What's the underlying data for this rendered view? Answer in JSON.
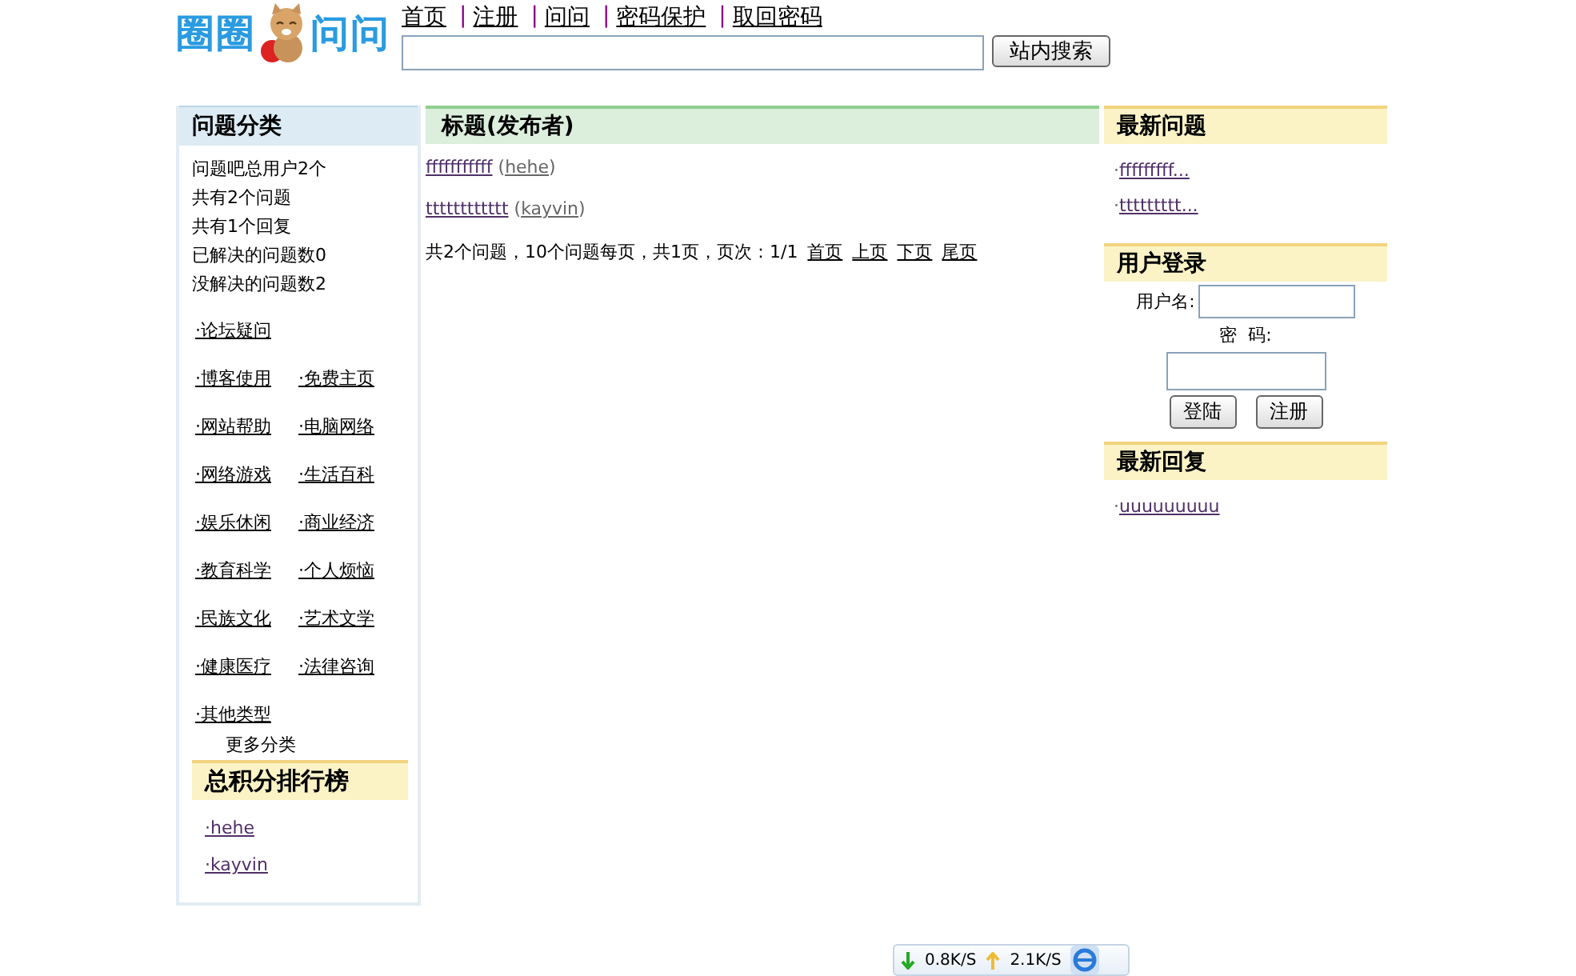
{
  "header": {
    "logo": [
      "圈圈",
      "问问"
    ],
    "nav": [
      {
        "label": "首页"
      },
      {
        "label": "注册"
      },
      {
        "label": "问问"
      },
      {
        "label": "密码保护"
      },
      {
        "label": "取回密码"
      }
    ],
    "nav_separator": "|",
    "search_button": "站内搜索"
  },
  "categories": {
    "title": "问题分类",
    "stats": [
      "问题吧总用户2个",
      "共有2个问题",
      "共有1个回复",
      "已解决的问题数0",
      "没解决的问题数2"
    ],
    "rows": [
      [
        "·论坛疑问"
      ],
      [
        "·博客使用",
        "·免费主页"
      ],
      [
        "·网站帮助",
        "·电脑网络"
      ],
      [
        "·网络游戏",
        "·生活百科"
      ],
      [
        "·娱乐休闲",
        "·商业经济"
      ],
      [
        "·教育科学",
        "·个人烦恼"
      ],
      [
        "·民族文化",
        "·艺术文学"
      ],
      [
        "·健康医疗",
        "·法律咨询"
      ],
      [
        "·其他类型"
      ]
    ],
    "more": "更多分类"
  },
  "ranking": {
    "title": "总积分排行榜",
    "users": [
      "·hehe",
      "·kayvin"
    ]
  },
  "questions": {
    "header": "标题(发布者)",
    "rows": [
      {
        "title": "fffffffffff",
        "open": "(",
        "author": "hehe",
        "close": ")"
      },
      {
        "title": "tttttttttttt",
        "open": "(",
        "author": "kayvin",
        "close": ")"
      }
    ],
    "summary": "共2个问题，10个问题每页，共1页，页次：1/1",
    "pager": [
      "首页",
      "上页",
      "下页",
      "尾页"
    ]
  },
  "latest_questions": {
    "title": "最新问题",
    "items": [
      {
        "bullet": "·",
        "text": "fffffffff..."
      },
      {
        "bullet": "·",
        "text": "ttttttttt..."
      }
    ]
  },
  "login": {
    "title": "用户登录",
    "username_label": "用户名:",
    "password_label": "密  码:",
    "buttons": [
      "登陆",
      "注册"
    ]
  },
  "latest_replies": {
    "title": "最新回复",
    "items": [
      {
        "bullet": "·",
        "text": "uuuuuuuuu"
      }
    ]
  },
  "speed_widget": {
    "download": "0.8K/S",
    "upload": "2.1K/S"
  }
}
